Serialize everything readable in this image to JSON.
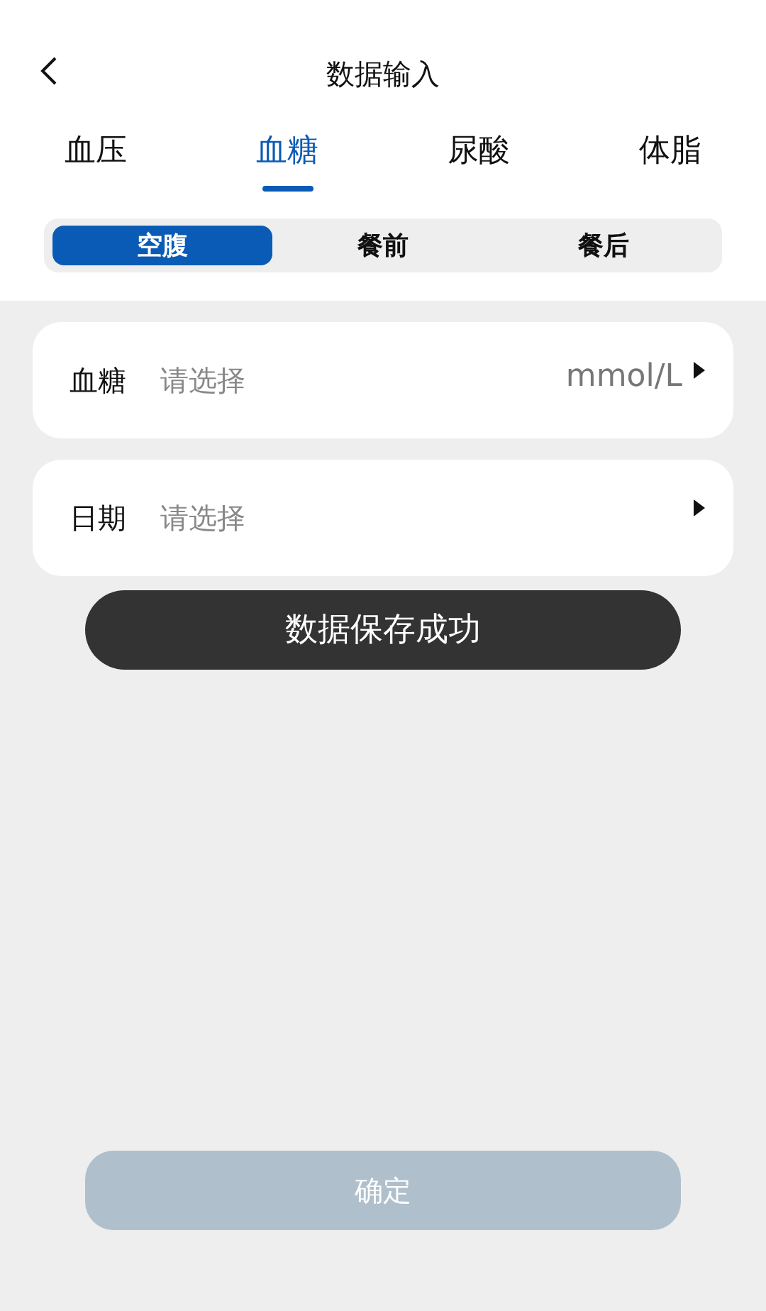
{
  "header": {
    "title": "数据输入"
  },
  "tabs": [
    {
      "label": "血压",
      "selected": false
    },
    {
      "label": "血糖",
      "selected": true
    },
    {
      "label": "尿酸",
      "selected": false
    },
    {
      "label": "体脂",
      "selected": false
    }
  ],
  "segments": [
    {
      "label": "空腹",
      "selected": true
    },
    {
      "label": "餐前",
      "selected": false
    },
    {
      "label": "餐后",
      "selected": false
    }
  ],
  "fields": [
    {
      "label": "血糖",
      "placeholder": "请选择",
      "unit": "mmol/L"
    },
    {
      "label": "日期",
      "placeholder": "请选择"
    }
  ],
  "toast": "数据保存成功",
  "confirm": {
    "label": "确定",
    "disabled": true
  }
}
